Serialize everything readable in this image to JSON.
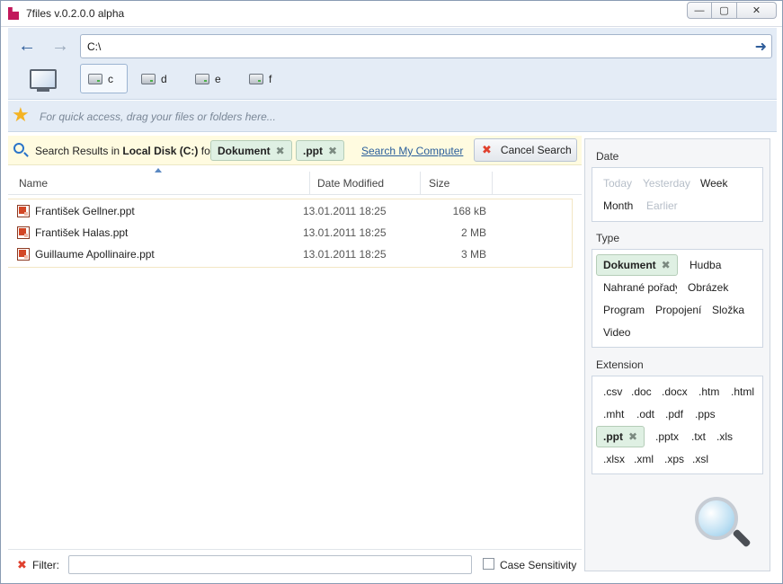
{
  "window": {
    "title": "7files v.0.2.0.0 alpha",
    "controls": {
      "minimize": "—",
      "maximize": "▢",
      "close": "✕"
    }
  },
  "nav": {
    "back": "←",
    "forward": "→",
    "address": "C:\\",
    "go": "➜"
  },
  "drives": [
    {
      "label": "c",
      "selected": true
    },
    {
      "label": "d",
      "selected": false
    },
    {
      "label": "e",
      "selected": false
    },
    {
      "label": "f",
      "selected": false
    }
  ],
  "favorites": {
    "placeholder": "For quick access, drag your files or folders here..."
  },
  "search": {
    "prefix": "Search Results in",
    "location": "Local Disk (C:)",
    "for": "for",
    "chips": [
      "Dokument",
      ".ppt"
    ],
    "chip_remove": "✖",
    "link": "Search My Computer",
    "cancel": "Cancel Search",
    "cancel_icon": "✖"
  },
  "table": {
    "columns": [
      "Name",
      "Date Modified",
      "Size"
    ],
    "rows": [
      {
        "name": "František Gellner.ppt",
        "date": "13.01.2011 18:25",
        "size": "168 kB"
      },
      {
        "name": "František Halas.ppt",
        "date": "13.01.2011 18:25",
        "size": "2 MB"
      },
      {
        "name": "Guillaume Apollinaire.ppt",
        "date": "13.01.2011 18:25",
        "size": "3 MB"
      }
    ]
  },
  "filter": {
    "icon": "✖",
    "label": "Filter:",
    "value": "",
    "case_label": "Case Sensitivity",
    "case_checked": false
  },
  "side": {
    "date": {
      "title": "Date",
      "options": [
        {
          "label": "Today",
          "enabled": false
        },
        {
          "label": "Yesterday",
          "enabled": false
        },
        {
          "label": "Week",
          "enabled": true
        },
        {
          "label": "Month",
          "enabled": true
        },
        {
          "label": "Earlier",
          "enabled": false
        }
      ]
    },
    "type": {
      "title": "Type",
      "selected": "Dokument",
      "options": [
        "Hudba",
        "Nahrané pořady",
        "Obrázek",
        "Program",
        "Propojení",
        "Složka",
        "Video"
      ]
    },
    "extension": {
      "title": "Extension",
      "selected": ".ppt",
      "options": [
        ".csv",
        ".doc",
        ".docx",
        ".htm",
        ".html",
        ".mht",
        ".odt",
        ".pdf",
        ".pps",
        ".pptx",
        ".txt",
        ".xls",
        ".xlsx",
        ".xml",
        ".xps",
        ".xsl"
      ]
    }
  }
}
